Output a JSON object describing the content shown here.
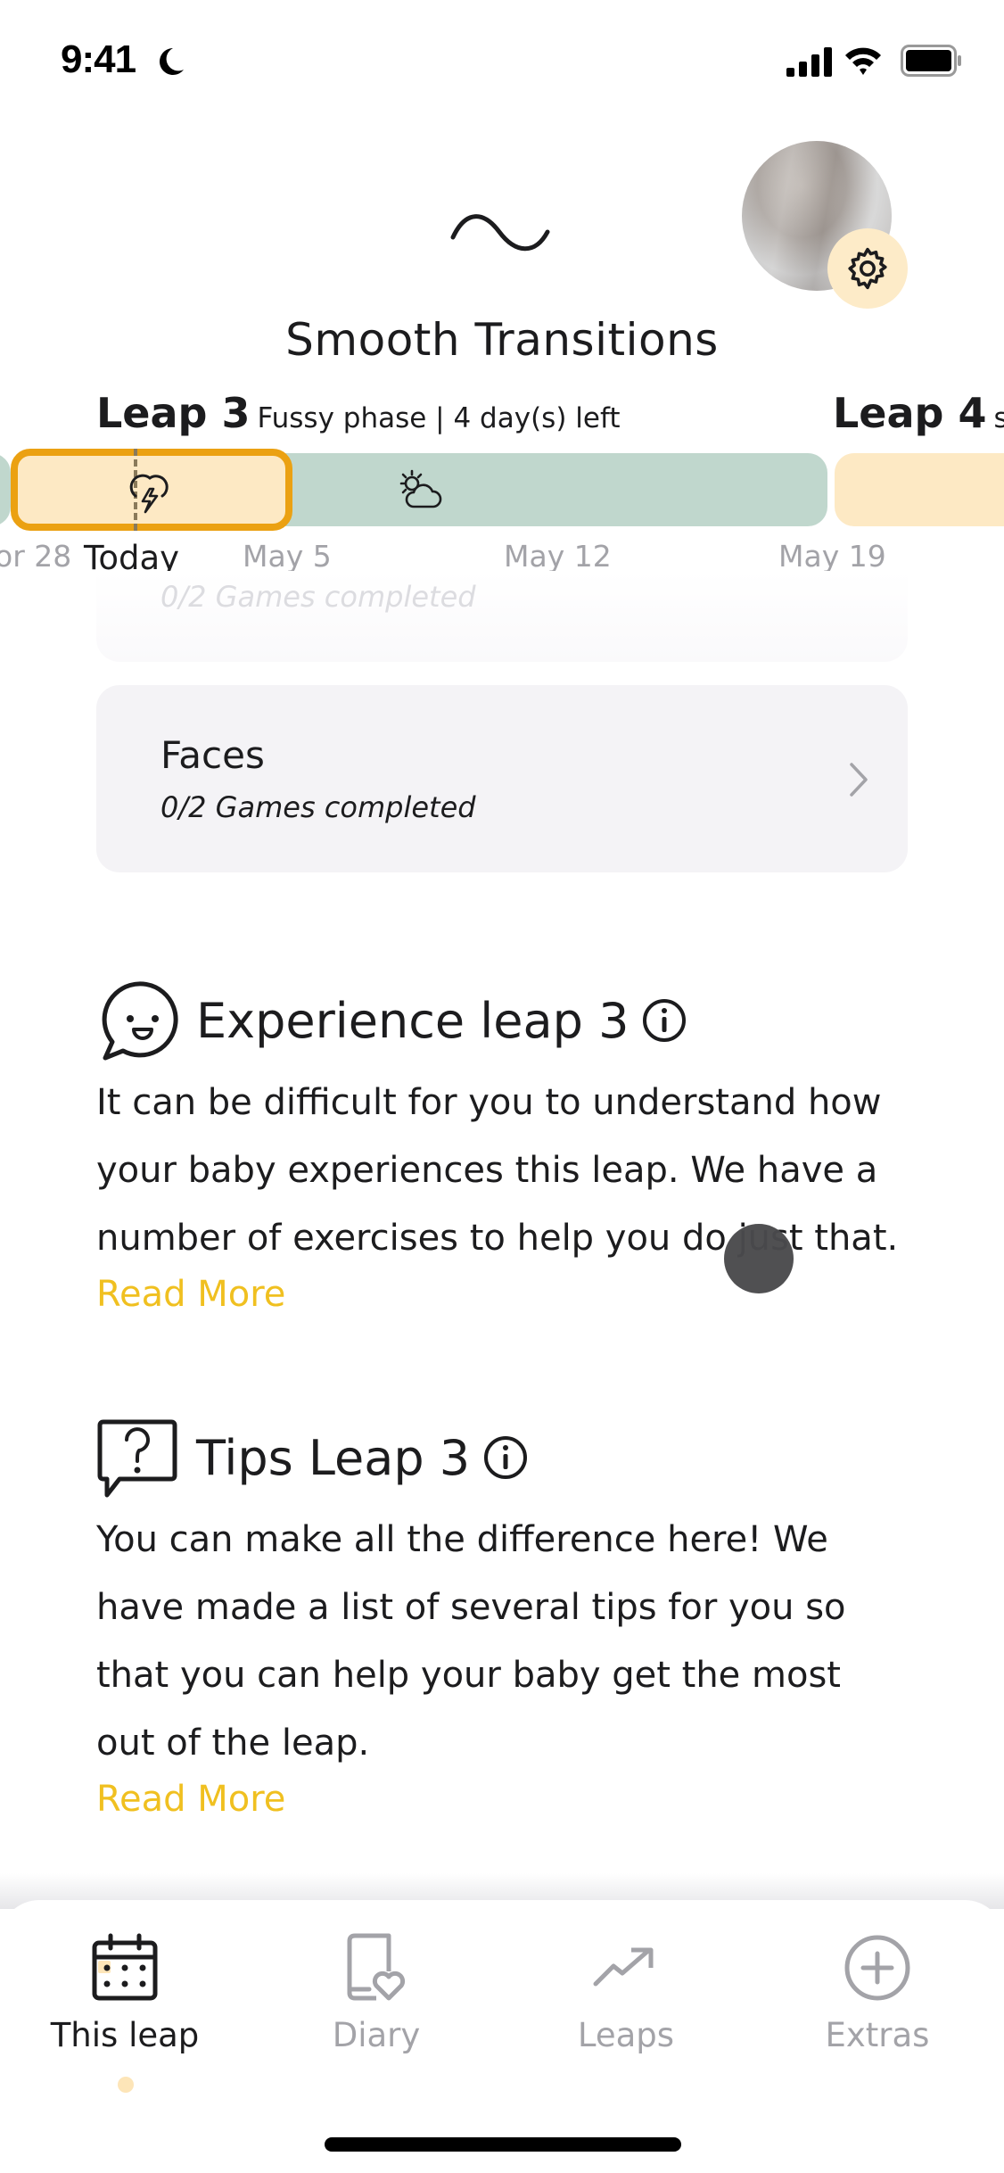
{
  "status_bar": {
    "time": "9:41",
    "focus_icon": "moon-icon",
    "icons": [
      "signal-icon",
      "wifi-icon",
      "battery-icon"
    ]
  },
  "header": {
    "leap_icon": "wave-icon",
    "title": "Smooth Transitions",
    "settings_icon": "gear-icon"
  },
  "timeline": {
    "current_leap": {
      "name": "Leap 3",
      "status": "Fussy phase | 4 day(s) left"
    },
    "next_leap": {
      "name": "Leap 4",
      "status": "s"
    },
    "dates": [
      "or 28",
      "Today",
      "May 5",
      "May 12",
      "May 19"
    ],
    "phase_icons": [
      "storm-icon",
      "sun-cloud-icon"
    ],
    "colors": {
      "fussy": "#fde9c4",
      "fussy_border": "#eba112",
      "calm": "#c0d7cd"
    }
  },
  "games": [
    {
      "title": "",
      "progress": "0/2 Games completed"
    },
    {
      "title": "Faces",
      "progress": "0/2 Games completed"
    }
  ],
  "sections": {
    "experience": {
      "icon": "smiley-speech-icon",
      "title": "Experience leap 3",
      "body": "It can be difficult for you to understand how your baby experiences this leap. We have a number of exercises to help you do just that.",
      "read_more": "Read More"
    },
    "tips": {
      "icon": "question-speech-icon",
      "title": "Tips Leap 3",
      "body": "You can make all the difference here! We have made a list of several tips for you so that you can help your baby get the most out of the leap.",
      "read_more": "Read More"
    }
  },
  "tabbar": {
    "tabs": [
      {
        "label": "This leap",
        "icon": "calendar-icon",
        "active": true
      },
      {
        "label": "Diary",
        "icon": "diary-heart-icon",
        "active": false
      },
      {
        "label": "Leaps",
        "icon": "trend-up-icon",
        "active": false
      },
      {
        "label": "Extras",
        "icon": "plus-circle-icon",
        "active": false
      }
    ]
  },
  "accent_color": "#f0c020"
}
